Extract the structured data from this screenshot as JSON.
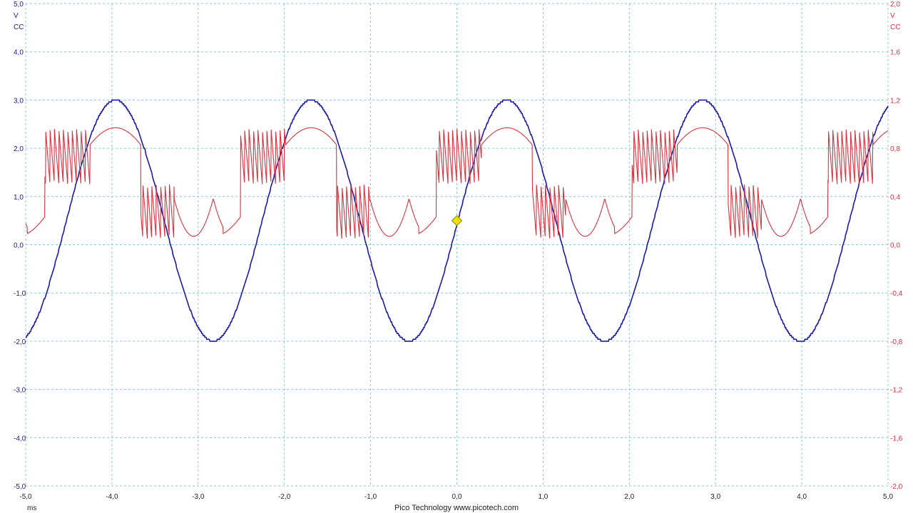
{
  "chart_data": {
    "type": "line",
    "x_unit": "ms",
    "xlim": [
      -5.0,
      5.0
    ],
    "x_ticks": [
      "-5,0",
      "-4,0",
      "-3,0",
      "-2,0",
      "-1,0",
      "0,0",
      "1,0",
      "2,0",
      "3,0",
      "4,0",
      "5,0"
    ],
    "left_axis": {
      "unit_lines": [
        "5,0",
        "V",
        "CC"
      ],
      "ylim": [
        -5.0,
        5.0
      ],
      "ticks": [
        "4,0",
        "3,0",
        "2,0",
        "1,0",
        "0,0",
        "-1,0",
        "-2,0",
        "-3,0",
        "-4,0",
        "-5,0"
      ],
      "color": "#1a1aa6"
    },
    "right_axis": {
      "unit_lines": [
        "2,0",
        "V",
        "CC"
      ],
      "ylim": [
        -2.0,
        2.0
      ],
      "ticks": [
        "1,6",
        "1,2",
        "0,8",
        "0,4",
        "0,0",
        "-0,4",
        "-0,8",
        "-1,2",
        "-1,6",
        "-2,0"
      ],
      "color": "#d9333f"
    },
    "grid": true,
    "series": [
      {
        "axis": "left",
        "color": "#1a1aa6",
        "shape": "sine",
        "period_ms": 2.27,
        "offset_v": 0.5,
        "amplitude_v": 2.5,
        "peak_at_ms": 0.58,
        "points": [
          [
            -5.0,
            -1.9
          ],
          [
            -4.0,
            3.0
          ],
          [
            -2.85,
            -2.0
          ],
          [
            -1.7,
            3.0
          ],
          [
            -0.55,
            -2.0
          ],
          [
            0.0,
            0.5
          ],
          [
            0.58,
            3.0
          ],
          [
            1.72,
            -2.0
          ],
          [
            2.85,
            3.0
          ],
          [
            4.0,
            -2.0
          ],
          [
            5.0,
            2.85
          ]
        ]
      },
      {
        "axis": "right",
        "color": "#d9333f",
        "shape": "sine with PWM switching segments",
        "period_ms": 2.27,
        "peak_v": 1.0,
        "min_v": 0.07,
        "switching_high_range_v": [
          0.5,
          0.96
        ],
        "switching_low_range_v": [
          0.05,
          0.5
        ],
        "points": [
          [
            -5.0,
            0.15
          ],
          [
            -4.0,
            0.97
          ],
          [
            -2.85,
            0.07
          ],
          [
            -1.7,
            0.97
          ],
          [
            -0.55,
            0.07
          ],
          [
            0.58,
            0.97
          ],
          [
            1.72,
            0.07
          ],
          [
            2.85,
            0.97
          ],
          [
            4.0,
            0.07
          ],
          [
            5.0,
            0.92
          ]
        ]
      }
    ],
    "trigger_marker": {
      "x": 0.0,
      "y": 0.5,
      "color": "#f0e000"
    }
  },
  "footer": {
    "brand": "Pico Technology  www.picotech.com"
  }
}
